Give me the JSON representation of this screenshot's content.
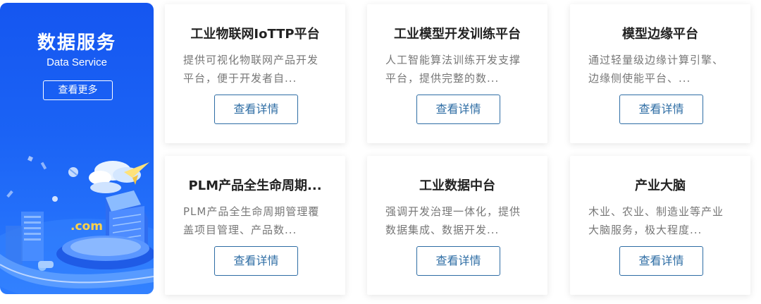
{
  "banner": {
    "title": "数据服务",
    "subtitle": "Data Service",
    "more_label": "查看更多",
    "illustration_text": ".com"
  },
  "cards": [
    {
      "title": "工业物联网IoTTP平台",
      "description": "提供可视化物联网产品开发平台，便于开发者自...",
      "button_label": "查看详情"
    },
    {
      "title": "工业模型开发训练平台",
      "description": "人工智能算法训练开发支撑平台，提供完整的数...",
      "button_label": "查看详情"
    },
    {
      "title": "模型边缘平台",
      "description": "通过轻量级边缘计算引擎、边缘侧使能平台、...",
      "button_label": "查看详情"
    },
    {
      "title": "PLM产品全生命周期...",
      "description": "PLM产品全生命周期管理覆盖项目管理、产品数...",
      "button_label": "查看详情"
    },
    {
      "title": "工业数据中台",
      "description": "强调开发治理一体化，提供数据集成、数据开发...",
      "button_label": "查看详情"
    },
    {
      "title": "产业大脑",
      "description": "木业、农业、制造业等产业大脑服务，极大程度...",
      "button_label": "查看详情"
    }
  ]
}
